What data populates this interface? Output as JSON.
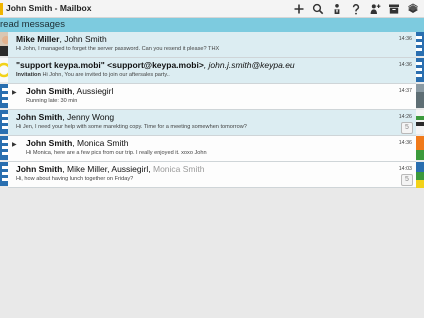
{
  "window": {
    "title": "John Smith - Mailbox"
  },
  "toolbar": {
    "actions": [
      {
        "name": "compose-icon",
        "glyph": "+"
      },
      {
        "name": "search-icon"
      },
      {
        "name": "contact-icon"
      },
      {
        "name": "help-icon",
        "glyph": "?"
      },
      {
        "name": "add-contact-icon"
      },
      {
        "name": "archive-icon"
      },
      {
        "name": "stack-icon"
      }
    ]
  },
  "section": {
    "title": "read messages"
  },
  "messages": [
    {
      "senders": [
        {
          "text": "Mike Miller",
          "style": "bold"
        },
        {
          "text": ", John Smith",
          "style": "normal"
        }
      ],
      "preview_tag": "",
      "preview": "Hi John, I managed to forget the server password. Can you resend it please? THX",
      "time": "14:36",
      "count": "",
      "highlighted": true,
      "forwarded": false
    },
    {
      "senders": [
        {
          "text": "\"support keypa.mobi\" <support@keypa.mobi>",
          "style": "bold"
        },
        {
          "text": ", john.j.smith@keypa.eu",
          "style": "italic"
        }
      ],
      "preview_tag": "Invitation",
      "preview": "Hi John, You are invited to join our aftersales party..",
      "time": "14:36",
      "count": "",
      "highlighted": true,
      "forwarded": false
    },
    {
      "senders": [
        {
          "text": "John Smith",
          "style": "bold"
        },
        {
          "text": ", Aussiegirl",
          "style": "normal"
        }
      ],
      "preview_tag": "",
      "preview": "Running late: 30 min",
      "time": "14:37",
      "count": "",
      "highlighted": false,
      "forwarded": true
    },
    {
      "senders": [
        {
          "text": "John Smith",
          "style": "bold"
        },
        {
          "text": ", Jenny Wong",
          "style": "normal"
        }
      ],
      "preview_tag": "",
      "preview": "Hi Jen, I need your help with some marekting copy.  Time for a meeting somewhen tomorrow?",
      "time": "14:26",
      "count": "5",
      "highlighted": true,
      "forwarded": false
    },
    {
      "senders": [
        {
          "text": "John Smith",
          "style": "bold"
        },
        {
          "text": ", Monica Smith",
          "style": "normal"
        }
      ],
      "preview_tag": "",
      "preview": "Hi Monica, here are a few pics from our trip.  I really enjoyed it.  xoxo John",
      "time": "14:36",
      "count": "",
      "highlighted": false,
      "forwarded": true
    },
    {
      "senders": [
        {
          "text": "John Smith",
          "style": "bold"
        },
        {
          "text": ", Mike Miller, Aussiegirl, ",
          "style": "normal"
        },
        {
          "text": "Monica Smith",
          "style": "muted"
        }
      ],
      "preview_tag": "",
      "preview": "Hi, how about having lunch together on Friday?",
      "time": "14:03",
      "count": "5",
      "highlighted": false,
      "forwarded": false
    }
  ],
  "colors": {
    "section_header": "#7dcbdf",
    "row_highlight": "#dcedf2",
    "row_plain": "#fdfdfd",
    "avatar_blue": "#2a6fb0",
    "avatar_yellow": "#f2d21a",
    "avatar_green": "#3c9a3c",
    "avatar_orange": "#f07a1a"
  }
}
